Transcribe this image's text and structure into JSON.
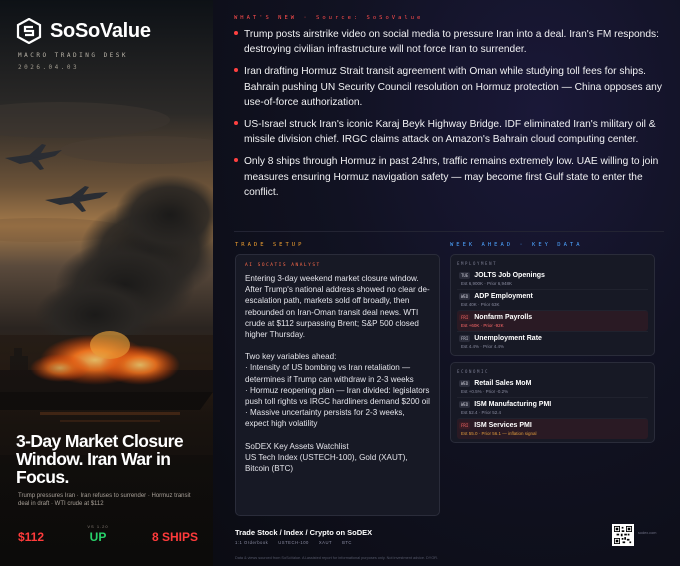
{
  "poster": {
    "brand": "SoSoValue",
    "desk": "MACRO TRADING DESK",
    "date": "2026.04.03",
    "headline": "3-Day Market Closure Window. Iran War in Focus.",
    "subline": "Trump pressures Iran · Iran refuses to surrender · Hormuz transit deal in draft · WTI crude at $112",
    "stats": [
      {
        "label": "",
        "value": "$112",
        "color": "#ff3b3b"
      },
      {
        "label": "VS 1.20",
        "value": "UP",
        "color": "#28d26a"
      },
      {
        "label": "",
        "value": "8 SHIPS",
        "color": "#ff3b3b"
      }
    ]
  },
  "news": {
    "tag": "WHAT'S NEW · Source: SoSoValue",
    "items": [
      "Trump posts airstrike video on social media to pressure Iran into a deal. Iran's FM responds: destroying civilian infrastructure will not force Iran to surrender.",
      "Iran drafting Hormuz Strait transit agreement with Oman while studying toll fees for ships. Bahrain pushing UN Security Council resolution on Hormuz protection — China opposes any use-of-force authorization.",
      "US-Israel struck Iran's iconic Karaj Beyk Highway Bridge. IDF eliminated Iran's military oil & missile division chief. IRGC claims attack on Amazon's Bahrain cloud computing center.",
      "Only 8 ships through Hormuz in past 24hrs, traffic remains extremely low. UAE willing to join measures ensuring Hormuz navigation safety — may become first Gulf state to enter the conflict."
    ]
  },
  "setup": {
    "tag": "TRADE SETUP",
    "analyst": "AI SOCATIS ANALYST",
    "p1": "Entering 3-day weekend market closure window. After Trump's national address showed no clear de-escalation path, markets sold off broadly, then rebounded on Iran-Oman transit deal news. WTI crude at $112 surpassing Brent; S&P 500 closed higher Thursday.",
    "p2_title": "Two key variables ahead:",
    "p2_l1": "· Intensity of US bombing vs Iran retaliation — determines if Trump can withdraw in 2-3 weeks",
    "p2_l2": "· Hormuz reopening plan — Iran divided: legislators push toll rights vs IRGC hardliners demand $200 oil",
    "p2_l3": "· Massive uncertainty persists for 2-3 weeks, expect high volatility",
    "p3_title": "SoDEX Key Assets Watchlist",
    "p3_body": "US Tech Index (USTECH-100), Gold (XAUT), Bitcoin (BTC)"
  },
  "week": {
    "tag": "WEEK AHEAD · KEY DATA",
    "groups": [
      {
        "label": "EMPLOYMENT",
        "events": [
          {
            "day": "TUE",
            "name": "JOLTS Job Openings",
            "meta": "Est 6,900K · Prior 6,948K",
            "hl": false,
            "red": false
          },
          {
            "day": "WED",
            "name": "ADP Employment",
            "meta": "Est 40K · Prior 63K",
            "hl": false,
            "red": false
          },
          {
            "day": "FRI",
            "name": "Nonfarm Payrolls",
            "meta": "Est +60K · Prior -92K",
            "hl": true,
            "red": true
          },
          {
            "day": "FRI",
            "name": "Unemployment Rate",
            "meta": "Est 4.4% · Prior 4.4%",
            "hl": false,
            "red": false
          }
        ]
      },
      {
        "label": "ECONOMIC",
        "events": [
          {
            "day": "WED",
            "name": "Retail Sales MoM",
            "meta": "Est +0.5% · Prior -0.2%",
            "hl": false,
            "red": false
          },
          {
            "day": "WED",
            "name": "ISM Manufacturing PMI",
            "meta": "Est 52.4 · Prior 52.4",
            "hl": false,
            "red": false
          },
          {
            "day": "FRI",
            "name": "ISM Services PMI",
            "meta": "Est 55.0 · Prior 56.1 — inflation signal",
            "hl": true,
            "red": true
          }
        ]
      }
    ]
  },
  "footer": {
    "title": "Trade Stock / Index / Crypto on SoDEX",
    "items": [
      "1:1 Orderbook",
      "USTECH-100",
      "XAUT",
      "BTC"
    ],
    "disclaimer": "Data & views sourced from SoSoValue. AI-assisted report for informational purposes only. Not investment advice. DYOR.",
    "qr_label": "sodex.com"
  }
}
